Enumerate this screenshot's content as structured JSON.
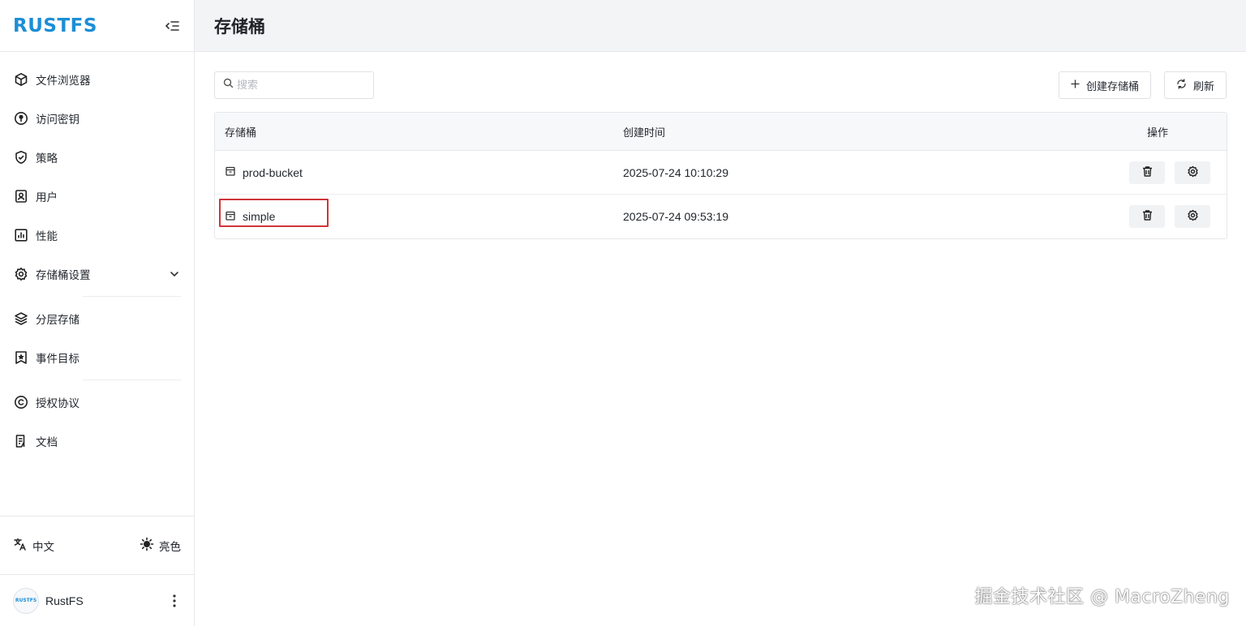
{
  "brand": {
    "logo_text": "RUSTFS"
  },
  "sidebar": {
    "items": [
      {
        "label": "文件浏览器",
        "icon": "cube-icon"
      },
      {
        "label": "访问密钥",
        "icon": "key-circle-icon"
      },
      {
        "label": "策略",
        "icon": "shield-check-icon"
      },
      {
        "label": "用户",
        "icon": "user-card-icon"
      },
      {
        "label": "性能",
        "icon": "bar-chart-icon"
      },
      {
        "label": "存储桶设置",
        "icon": "gear-icon"
      },
      {
        "label": "分层存储",
        "icon": "layers-icon"
      },
      {
        "label": "事件目标",
        "icon": "star-bookmark-icon"
      },
      {
        "label": "授权协议",
        "icon": "copyright-icon"
      },
      {
        "label": "文档",
        "icon": "document-icon"
      }
    ],
    "language_label": "中文",
    "theme_label": "亮色",
    "user_name": "RustFS",
    "avatar_text": "RUSTFS"
  },
  "header": {
    "title": "存储桶"
  },
  "toolbar": {
    "search_placeholder": "搜索",
    "create_label": "创建存储桶",
    "refresh_label": "刷新"
  },
  "table": {
    "columns": [
      "存储桶",
      "创建时间",
      "操作"
    ],
    "rows": [
      {
        "name": "prod-bucket",
        "created": "2025-07-24 10:10:29"
      },
      {
        "name": "simple",
        "created": "2025-07-24 09:53:19"
      }
    ]
  },
  "watermark": "掘金技术社区 @ MacroZheng",
  "colors": {
    "brand": "#1c8ed6",
    "highlight": "#d0343a"
  }
}
